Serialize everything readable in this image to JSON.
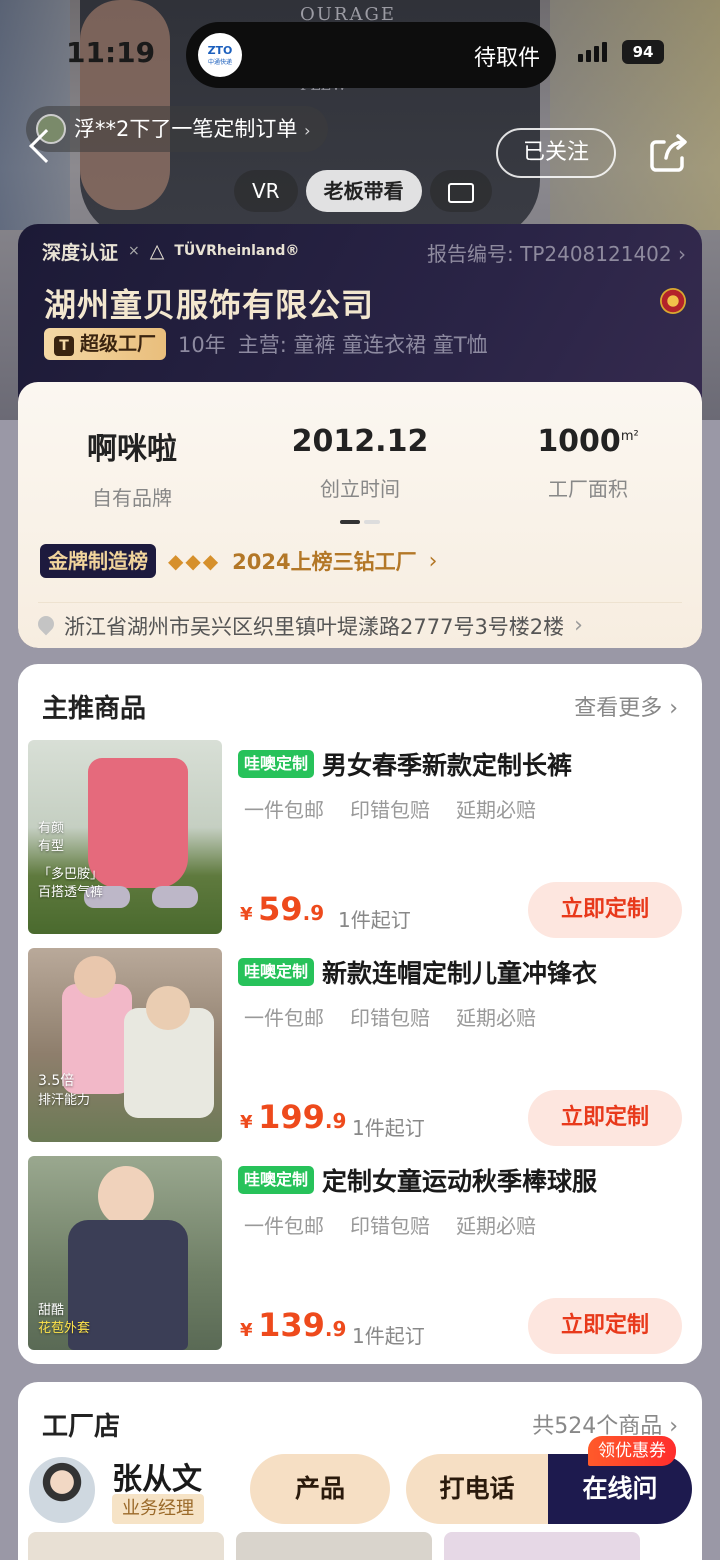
{
  "status_bar": {
    "time": "11:19",
    "island_text": "待取件",
    "courier_logo": "ZTO",
    "courier_name": "中通快递",
    "battery": "94"
  },
  "hero": {
    "shirt_text_1": "OURAGE",
    "shirt_text_2": "FLEW",
    "order_ticker": "浮**2下了一笔定制订单",
    "follow_label": "已关注",
    "media_tabs": [
      {
        "label": "VR",
        "active": false
      },
      {
        "label": "老板带看",
        "active": true
      }
    ]
  },
  "factory": {
    "cert_1": "深度认证",
    "cert_2": "TÜVRheinland®",
    "report_no": "报告编号: TP2408121402",
    "company_name": "湖州童贝服饰有限公司",
    "badge": "超级工厂",
    "years": "10年",
    "main_business": "主营: 童裤 童连衣裙 童T恤",
    "stats": [
      {
        "value": "啊咪啦",
        "label": "自有品牌"
      },
      {
        "value": "2012.12",
        "label": "创立时间"
      },
      {
        "value": "1000",
        "unit": "m²",
        "label": "工厂面积"
      }
    ],
    "gold_tag": "金牌制造榜",
    "gold_text": "2024上榜三钻工厂",
    "address": "浙江省湖州市吴兴区织里镇叶堤漾路2777号3号楼2楼"
  },
  "recommended": {
    "title": "主推商品",
    "more": "查看更多",
    "products": [
      {
        "tag": "哇噢定制",
        "name": "男女春季新款定制长裤",
        "perks": [
          "一件包邮",
          "印错包赔",
          "延期必赔"
        ],
        "price_int": "59",
        "price_dec": ".9",
        "moq": "1件起订",
        "buy": "立即定制",
        "img_caption": [
          "有颜",
          "有型",
          "「多巴胺」",
          "百搭透气裤"
        ]
      },
      {
        "tag": "哇噢定制",
        "name": "新款连帽定制儿童冲锋衣",
        "perks": [
          "一件包邮",
          "印错包赔",
          "延期必赔"
        ],
        "price_int": "199",
        "price_dec": ".9",
        "moq": "1件起订",
        "buy": "立即定制",
        "img_caption": [
          "3.5倍",
          "排汗能力"
        ]
      },
      {
        "tag": "哇噢定制",
        "name": "定制女童运动秋季棒球服",
        "perks": [
          "一件包邮",
          "印错包赔",
          "延期必赔"
        ],
        "price_int": "139",
        "price_dec": ".9",
        "moq": "1件起订",
        "buy": "立即定制",
        "img_caption": [
          "甜酷",
          "花苞外套"
        ]
      }
    ],
    "currency": "¥"
  },
  "store": {
    "title": "工厂店",
    "count": "共524个商品"
  },
  "bottom_bar": {
    "rep_name": "张从文",
    "rep_role": "业务经理",
    "product_btn": "产品",
    "call_btn": "打电话",
    "chat_btn": "在线问",
    "coupon": "领优惠券"
  }
}
